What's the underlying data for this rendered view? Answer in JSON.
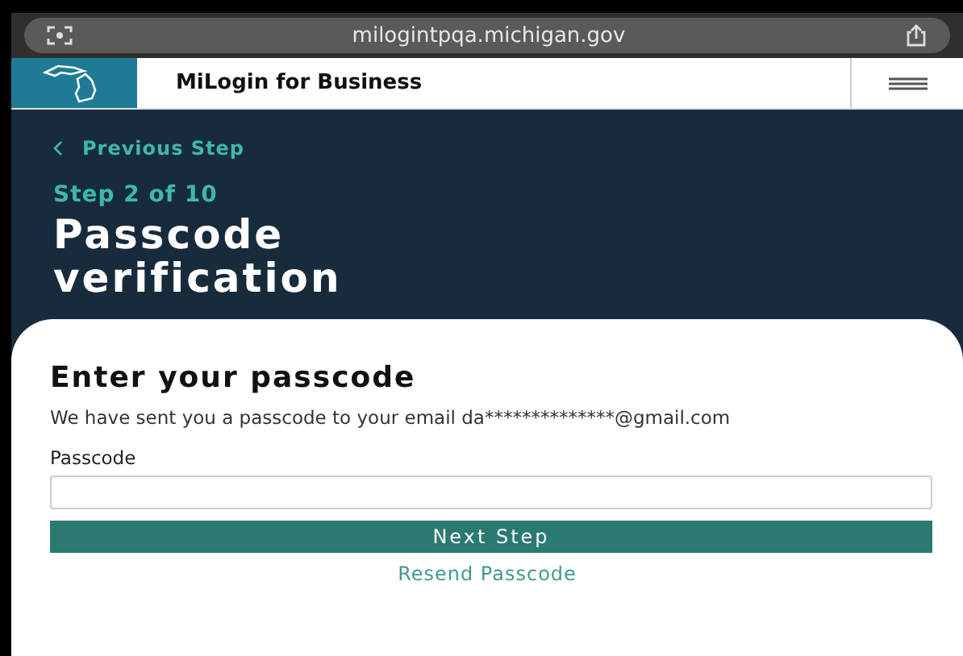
{
  "browser": {
    "url": "milogintpqa.michigan.gov"
  },
  "header": {
    "title": "MiLogin for Business"
  },
  "hero": {
    "back_link": "Previous Step",
    "step": "Step 2 of 10",
    "title": "Passcode verification"
  },
  "card": {
    "heading": "Enter your passcode",
    "message": "We have sent you a passcode to your email da**************@gmail.com",
    "field": {
      "label": "Passcode"
    },
    "primary_button": "Next Step",
    "link": "Resend Passcode"
  }
}
